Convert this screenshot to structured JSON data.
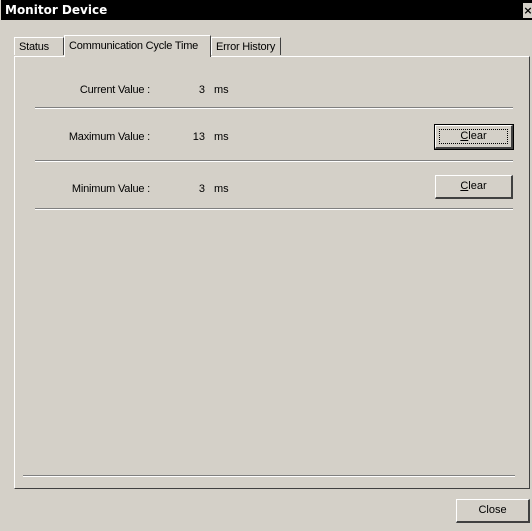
{
  "window": {
    "title": "Monitor Device",
    "close_glyph": "×"
  },
  "tabs": [
    {
      "label": "Status"
    },
    {
      "label": "Communication Cycle Time"
    },
    {
      "label": "Error History"
    }
  ],
  "rows": {
    "current": {
      "label": "Current Value :",
      "value": "3",
      "unit": "ms"
    },
    "maximum": {
      "label": "Maximum Value :",
      "value": "13",
      "unit": "ms",
      "button_hotkey": "C",
      "button_rest": "lear"
    },
    "minimum": {
      "label": "Minimum Value :",
      "value": "3",
      "unit": "ms",
      "button_hotkey": "C",
      "button_rest": "lear"
    }
  },
  "footer": {
    "close_label": "Close"
  }
}
